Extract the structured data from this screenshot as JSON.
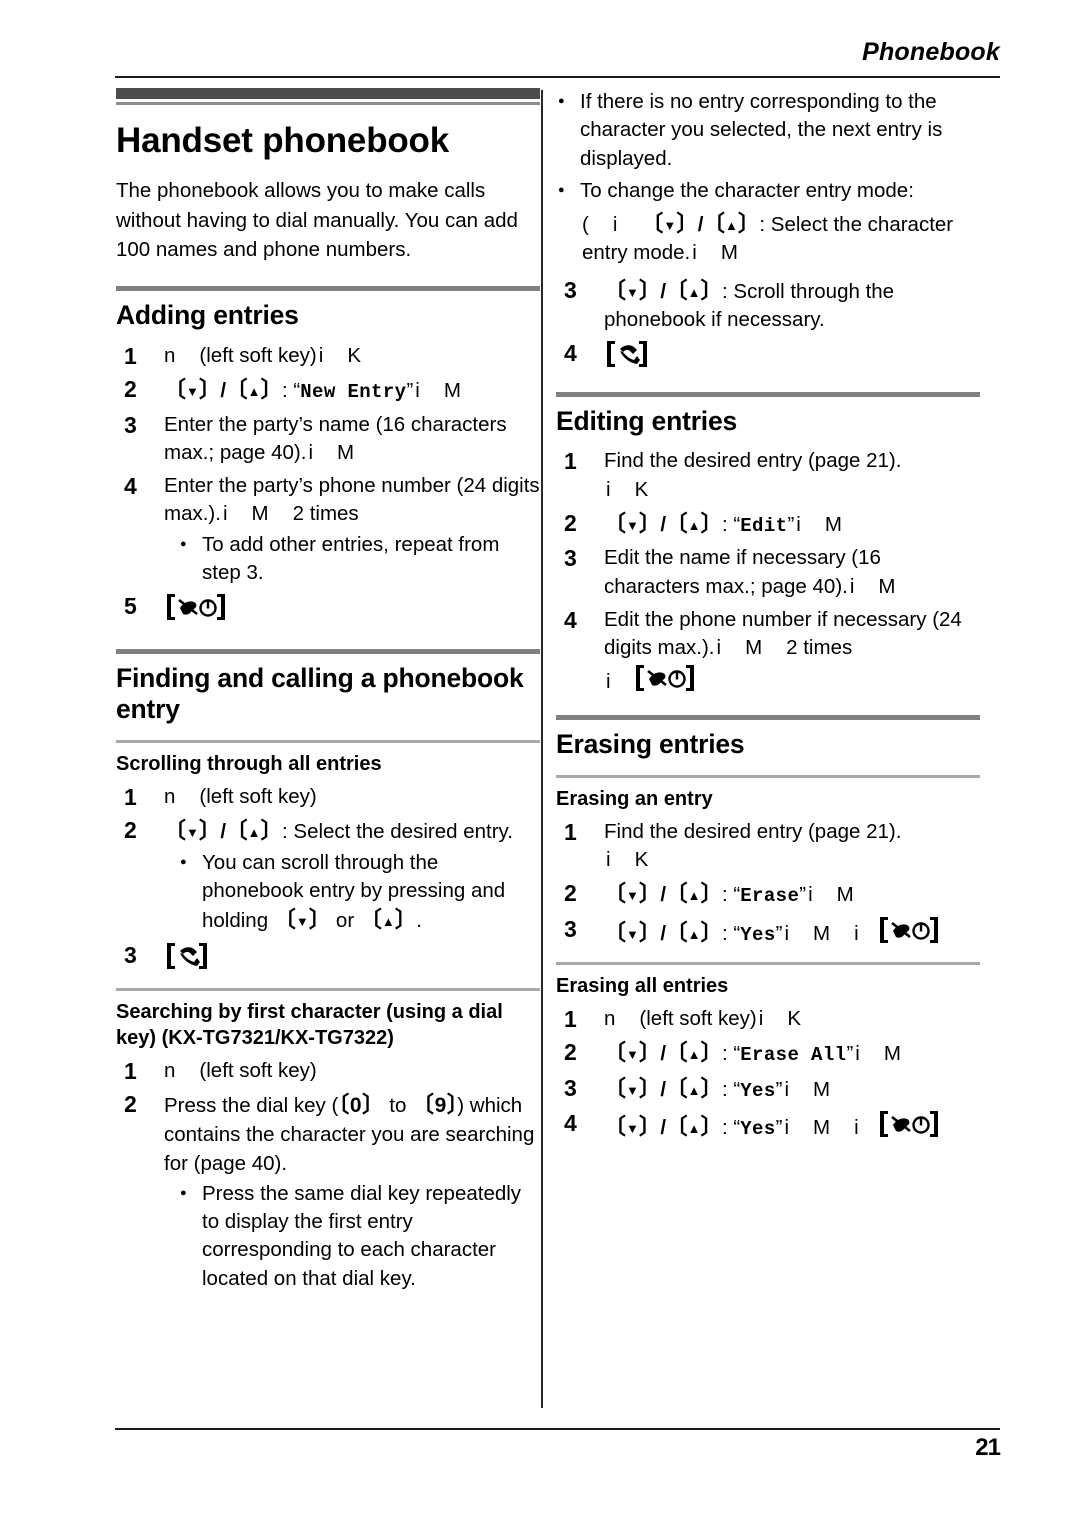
{
  "page": {
    "running_head": "Phonebook",
    "folio": "21"
  },
  "chapter": {
    "title": "Handset phonebook",
    "intro": "The phonebook allows you to make calls without having to dial manually. You can add 100 names and phone numbers."
  },
  "sections": {
    "adding": {
      "title": "Adding entries",
      "steps": [
        {
          "num": "1",
          "pre": "n",
          "text": "(left soft key)",
          "post_i": "i",
          "post_k": "K"
        },
        {
          "num": "2",
          "colon": ":",
          "quoted": "New Entry",
          "post_i": "i",
          "post_m": "M"
        },
        {
          "num": "3",
          "text": "Enter the party’s name (16 characters max.; page 40).",
          "post_i": "i",
          "post_m": "M"
        },
        {
          "num": "4",
          "text": "Enter the party’s phone number (24 digits max.).",
          "post_i": "i",
          "post_m": "M",
          "times": "2 times",
          "bullet": "To add other entries, repeat from step 3."
        },
        {
          "num": "5",
          "icon": "power-off-key-icon"
        }
      ]
    },
    "finding": {
      "title": "Finding and calling a phonebook entry",
      "sub_scrolling": {
        "title": "Scrolling through all entries",
        "steps": [
          {
            "num": "1",
            "pre": "n",
            "text": "(left soft key)"
          },
          {
            "num": "2",
            "colon": ": Select the desired entry.",
            "bullet_lead": "You can scroll through the phonebook entry by pressing and holding ",
            "bullet_mid": " or ",
            "bullet_end": "."
          },
          {
            "num": "3",
            "icon": "talk-key-icon"
          }
        ]
      },
      "sub_searching": {
        "title": "Searching by first character (using a dial key) (KX-TG7321/KX-TG7322)",
        "steps": [
          {
            "num": "1",
            "pre": "n",
            "text": "(left soft key)"
          },
          {
            "num": "2",
            "lead": "Press the dial key (",
            "key_low": "0",
            "mid": " to ",
            "key_high": "9",
            "tail": ") which contains the character you are searching for (page 40).",
            "bullet": "Press the same dial key repeatedly to display the first entry corresponding to each character located on that dial key."
          }
        ],
        "continued_bullets": [
          "If there is no entry corresponding to the character you selected, the next entry is displayed.",
          "To change the character entry mode:"
        ],
        "mode_line_open": "(",
        "mode_line_i": "i",
        "mode_line_colon": ": Select the character entry mode.",
        "mode_line_i2": "i",
        "mode_line_m": "M",
        "steps_cont": [
          {
            "num": "3",
            "colon": ": Scroll through the phonebook if necessary."
          },
          {
            "num": "4",
            "icon": "talk-key-icon"
          }
        ]
      }
    },
    "editing": {
      "title": "Editing entries",
      "steps": [
        {
          "num": "1",
          "text": "Find the desired entry (page 21).",
          "post_i": "i",
          "post_k": "K"
        },
        {
          "num": "2",
          "colon": ":",
          "quoted": "Edit",
          "post_i": "i",
          "post_m": "M"
        },
        {
          "num": "3",
          "text": "Edit the name if necessary (16 characters max.; page 40).",
          "post_i": "i",
          "post_m": "M"
        },
        {
          "num": "4",
          "text": "Edit the phone number if necessary (24 digits max.).",
          "post_i": "i",
          "post_m": "M",
          "times": "2 times",
          "tail_i": "i",
          "icon": "power-off-key-icon"
        }
      ]
    },
    "erasing": {
      "title": "Erasing entries",
      "sub_entry": {
        "title": "Erasing an entry",
        "steps": [
          {
            "num": "1",
            "text": "Find the desired entry (page 21).",
            "post_i": "i",
            "post_k": "K"
          },
          {
            "num": "2",
            "colon": ":",
            "quoted": "Erase",
            "post_i": "i",
            "post_m": "M"
          },
          {
            "num": "3",
            "colon": ":",
            "quoted": "Yes",
            "post_i": "i",
            "post_m": "M",
            "tail_i": "i",
            "icon": "power-off-key-icon"
          }
        ]
      },
      "sub_all": {
        "title": "Erasing all entries",
        "steps": [
          {
            "num": "1",
            "pre": "n",
            "text": "(left soft key)",
            "post_i": "i",
            "post_k": "K"
          },
          {
            "num": "2",
            "colon": ":",
            "quoted": "Erase All",
            "post_i": "i",
            "post_m": "M"
          },
          {
            "num": "3",
            "colon": ":",
            "quoted": "Yes",
            "post_i": "i",
            "post_m": "M"
          },
          {
            "num": "4",
            "colon": ":",
            "quoted": "Yes",
            "post_i": "i",
            "post_m": "M",
            "tail_i": "i",
            "icon": "power-off-key-icon"
          }
        ]
      }
    }
  },
  "glyphs": {
    "bracket_open": "〔",
    "bracket_close": "〕",
    "down_triangle": "▼",
    "up_triangle": "▲",
    "quote_open": "“",
    "quote_close": "”"
  },
  "colors": {
    "chapter_bar": "#4c4c4c",
    "section_rule": "#808080",
    "subsection_rule": "#a8a8a8",
    "text": "#000000",
    "page_bg": "#ffffff"
  }
}
